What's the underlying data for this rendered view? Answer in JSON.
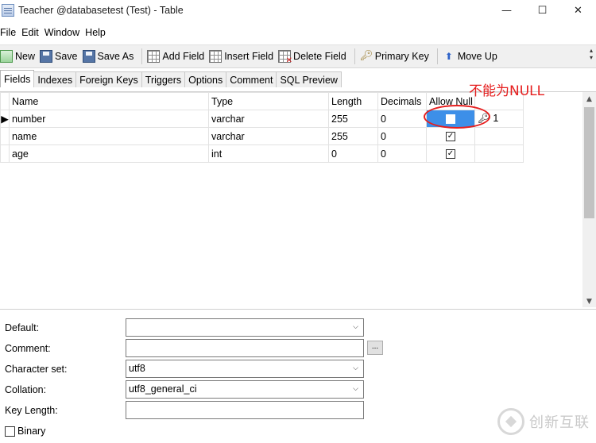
{
  "window": {
    "title": "Teacher @databasetest (Test) - Table",
    "minimize": "—",
    "maximize": "☐",
    "close": "✕"
  },
  "menu": [
    "File",
    "Edit",
    "Window",
    "Help"
  ],
  "toolbar": {
    "new": "New",
    "save": "Save",
    "save_as": "Save As",
    "add_field": "Add Field",
    "insert_field": "Insert Field",
    "delete_field": "Delete Field",
    "primary_key": "Primary Key",
    "move_up": "Move Up",
    "more": "▲▼"
  },
  "tabs": [
    "Fields",
    "Indexes",
    "Foreign Keys",
    "Triggers",
    "Options",
    "Comment",
    "SQL Preview"
  ],
  "active_tab": "Fields",
  "grid": {
    "columns": [
      "Name",
      "Type",
      "Length",
      "Decimals",
      "Allow Null"
    ],
    "rows": [
      {
        "name": "number",
        "type": "varchar",
        "length": "255",
        "decimals": "0",
        "allow_null": false,
        "key": "1",
        "current": true
      },
      {
        "name": "name",
        "type": "varchar",
        "length": "255",
        "decimals": "0",
        "allow_null": true,
        "key": "",
        "current": false
      },
      {
        "name": "age",
        "type": "int",
        "length": "0",
        "decimals": "0",
        "allow_null": true,
        "key": "",
        "current": false
      }
    ],
    "annotation": "不能为NULL",
    "annotation_color": "#e61e1e",
    "selection_color": "#3d8fe8"
  },
  "properties": {
    "default_label": "Default:",
    "default_value": "",
    "comment_label": "Comment:",
    "comment_value": "",
    "comment_button": "...",
    "charset_label": "Character set:",
    "charset_value": "utf8",
    "collation_label": "Collation:",
    "collation_value": "utf8_general_ci",
    "keylength_label": "Key Length:",
    "keylength_value": "",
    "binary_label": "Binary"
  },
  "watermark": "创新互联"
}
